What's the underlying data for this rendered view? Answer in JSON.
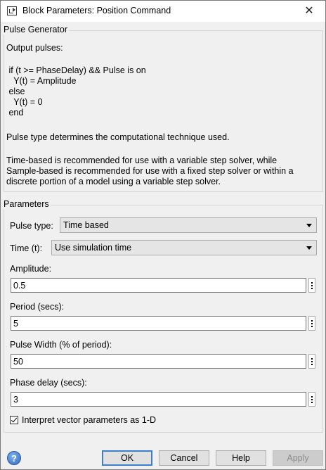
{
  "window": {
    "title": "Block Parameters: Position Command",
    "close_glyph": "✕",
    "icon": "simulink-block-icon"
  },
  "description_group": {
    "title": "Pulse Generator",
    "line1": "Output pulses:",
    "code": " if (t >= PhaseDelay) && Pulse is on\n   Y(t) = Amplitude\n else\n   Y(t) = 0\n end",
    "line2": "Pulse type determines the computational technique used.",
    "line3": "Time-based is recommended for use with a variable step solver, while\nSample-based is recommended for use with a fixed step solver or within a\ndiscrete portion of a model using a variable step solver."
  },
  "parameters_group": {
    "title": "Parameters",
    "pulse_type": {
      "label": "Pulse type:",
      "value": "Time based"
    },
    "time": {
      "label": "Time (t):",
      "value": "Use simulation time"
    },
    "amplitude": {
      "label": "Amplitude:",
      "value": "0.5"
    },
    "period": {
      "label": "Period (secs):",
      "value": "5"
    },
    "pulse_width": {
      "label": "Pulse Width (% of period):",
      "value": "50"
    },
    "phase_delay": {
      "label": "Phase delay (secs):",
      "value": "3"
    },
    "interpret_vector": {
      "label": "Interpret vector parameters as 1-D",
      "checked": true
    }
  },
  "buttons": {
    "help_glyph": "?",
    "ok": "OK",
    "cancel": "Cancel",
    "help": "Help",
    "apply": "Apply"
  }
}
